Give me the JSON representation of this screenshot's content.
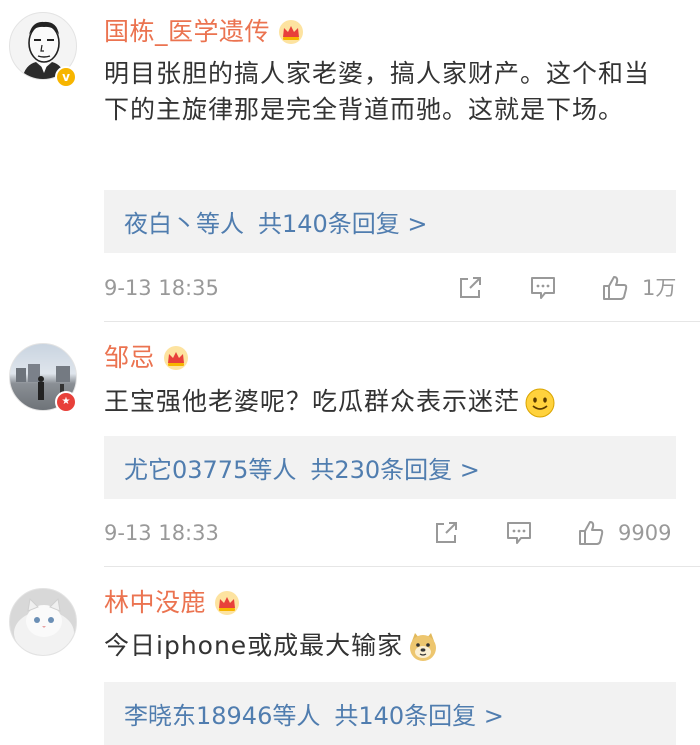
{
  "comments": [
    {
      "username": "国栋_医学遗传",
      "text": "明目张胆的搞人家老婆，搞人家财产。这个和当下的主旋律那是完全背道而驰。这就是下场。",
      "reply_users": "夜白丶等人",
      "reply_count": "共140条回复 >",
      "time": "9-13 18:35",
      "likes": "1万",
      "badge": "v"
    },
    {
      "username": "邹忌",
      "text": "王宝强他老婆呢？吃瓜群众表示迷茫",
      "reply_users": "尤它03775等人",
      "reply_count": "共230条回复 >",
      "time": "9-13 18:33",
      "likes": "9909",
      "badge": "★"
    },
    {
      "username": "林中没鹿",
      "text": "今日iphone或成最大输家",
      "reply_users": "李晓东18946等人",
      "reply_count": "共140条回复 >"
    }
  ],
  "colors": {
    "name": "#eb7350",
    "link": "#507daf",
    "meta": "#999999",
    "reply_bg": "#f2f2f2"
  },
  "icons": [
    "crown-icon",
    "share-icon",
    "comment-icon",
    "like-icon",
    "smile-emoji",
    "doge-emoji"
  ]
}
